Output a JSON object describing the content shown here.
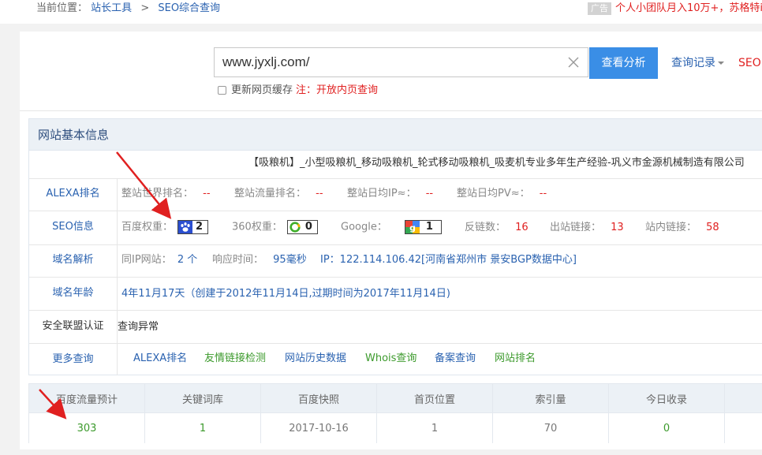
{
  "breadcrumb": {
    "prefix": "当前位置：",
    "item1": "站长工具",
    "separator": ">",
    "item2": "SEO综合查询"
  },
  "ad": {
    "tag": "广告",
    "text": "个人小团队月入10万+，苏格特i"
  },
  "search": {
    "value": "www.jyxlj.com/",
    "button_label": "查看分析",
    "history_label": "查询记录",
    "seo_link": "SEO"
  },
  "cache": {
    "checkbox_label": "更新网页缓存",
    "note_prefix": "注：",
    "note_link": "开放内页查询"
  },
  "panel": {
    "title": "网站基本信息",
    "site_title": "【吸粮机】_小型吸粮机_移动吸粮机_轮式移动吸粮机_吸麦机专业多年生产经验-巩义市金源机械制造有限公司"
  },
  "alexa": {
    "label": "ALEXA排名",
    "world_label": "整站世界排名：",
    "world_value": "--",
    "traffic_label": "整站流量排名：",
    "traffic_value": "--",
    "ip_label": "整站日均IP≈：",
    "ip_value": "--",
    "pv_label": "整站日均PV≈：",
    "pv_value": "--"
  },
  "seo": {
    "label": "SEO信息",
    "baidu_label": "百度权重：",
    "baidu_value": "2",
    "so360_label": "360权重：",
    "so360_value": "0",
    "google_label": "Google：",
    "google_value": "1",
    "backlinks_label": "反链数：",
    "backlinks_value": "16",
    "outlinks_label": "出站链接：",
    "outlinks_value": "13",
    "inlinks_label": "站内链接：",
    "inlinks_value": "58"
  },
  "domain": {
    "label": "域名解析",
    "sameip_label": "同IP网站：",
    "sameip_value": "2 个",
    "response_label": "响应时间：",
    "response_value": "95毫秒",
    "ip_text": "IP：122.114.106.42[河南省郑州市 景安BGP数据中心]"
  },
  "age": {
    "label": "域名年龄",
    "value": "4年11月17天（创建于2012年11月14日,过期时间为2017年11月14日)"
  },
  "security": {
    "label": "安全联盟认证",
    "value": "查询异常"
  },
  "more": {
    "label": "更多查询",
    "links": [
      "ALEXA排名",
      "友情链接检测",
      "网站历史数据",
      "Whois查询",
      "备案查询",
      "网站排名"
    ]
  },
  "stats": {
    "headers": [
      "百度流量预计",
      "关键词库",
      "百度快照",
      "首页位置",
      "索引量",
      "今日收录",
      ""
    ],
    "values": [
      "303",
      "1",
      "2017-10-16",
      "1",
      "70",
      "0",
      ""
    ]
  },
  "colors": {
    "accent": "#3a8ee6",
    "link": "#2a62b0",
    "red": "#e02020",
    "green": "#3c9a2c",
    "panel_head": "#ecf1f6"
  }
}
